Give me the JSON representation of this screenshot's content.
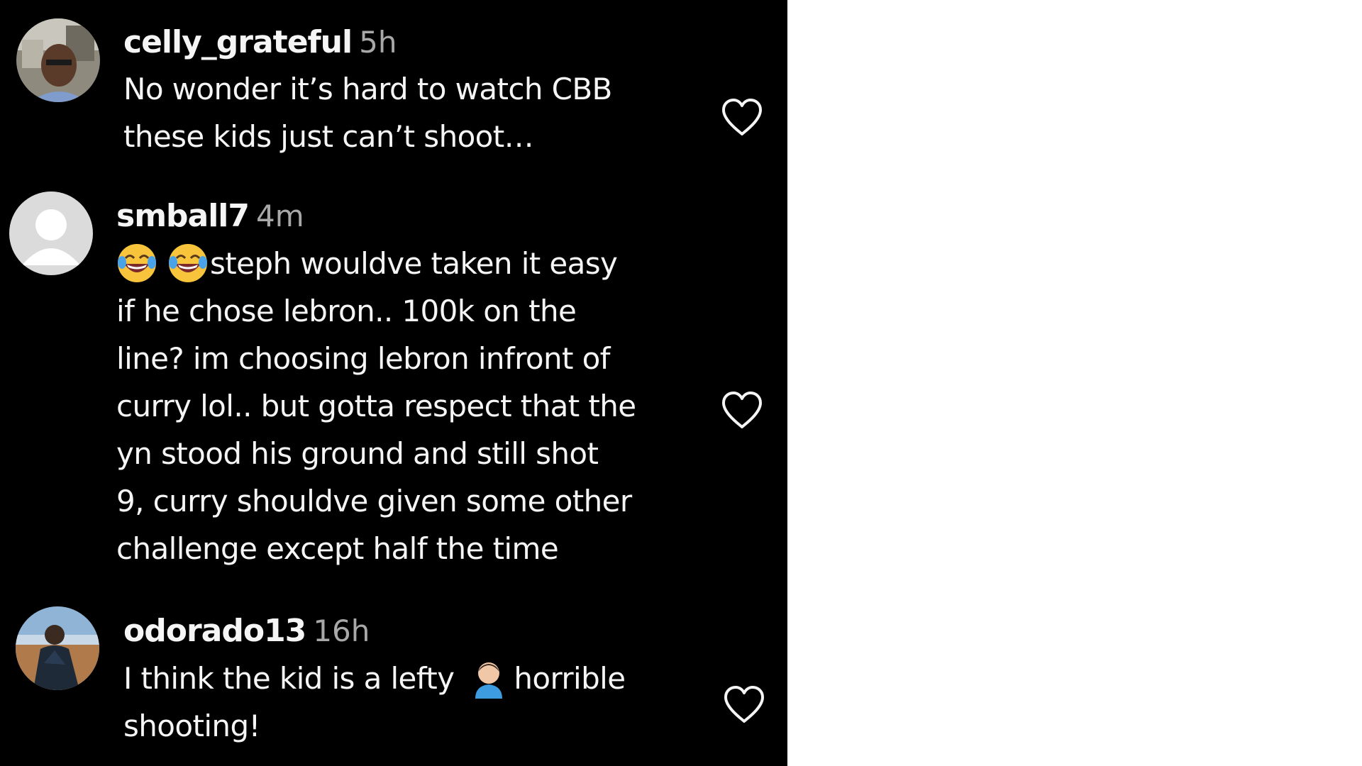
{
  "comments": [
    {
      "username": "celly_grateful",
      "timestamp": "5h",
      "lines": [
        "No wonder it’s hard to watch CBB",
        "these kids just can’t shoot…"
      ],
      "avatar": "profile-photo"
    },
    {
      "username": "smball7",
      "timestamp": "4m",
      "emoji_prefix": [
        "face-with-tears-of-joy-emoji",
        "face-with-tears-of-joy-emoji"
      ],
      "first_line_text": "steph wouldve taken it easy",
      "lines": [
        "if he chose lebron.. 100k on the",
        "line? im choosing lebron infront of",
        "curry lol.. but gotta respect that the",
        "yn stood his ground and still shot",
        "9, curry shouldve given some other",
        "challenge except half the time"
      ],
      "avatar": "default-avatar"
    },
    {
      "username": "odorado13",
      "timestamp": "16h",
      "text_before_emoji": "I think the kid is a lefty",
      "inline_emoji": "person-facepalming-emoji",
      "text_after_emoji": "horrible",
      "lines": [
        "shooting!"
      ],
      "avatar": "profile-photo"
    }
  ],
  "like_icon": "heart-outline-icon",
  "colors": {
    "background": "#000000",
    "text": "#f5f5f5",
    "secondary": "#a8a8a8"
  }
}
